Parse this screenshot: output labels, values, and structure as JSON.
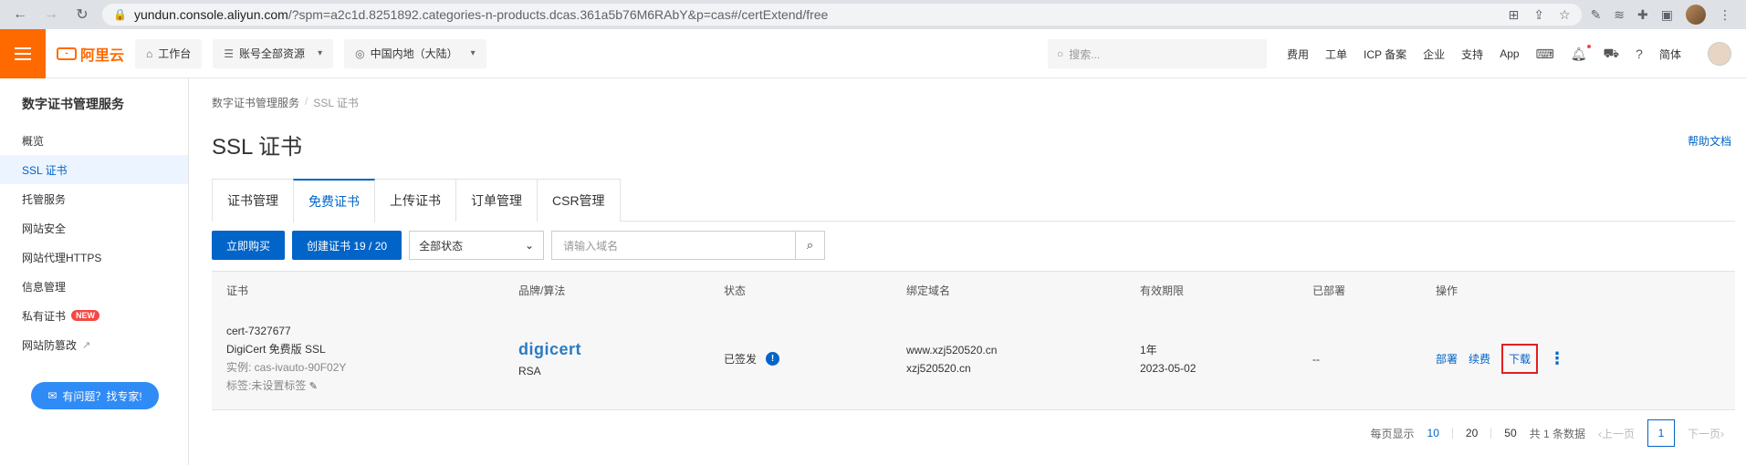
{
  "browser": {
    "url_domain": "yundun.console.aliyun.com",
    "url_path": "/?spm=a2c1d.8251892.categories-n-products.dcas.361a5b76M6RAbY&p=cas#/certExtend/free"
  },
  "topnav": {
    "logo_text": "阿里云",
    "workbench": "工作台",
    "account_resources": "账号全部资源",
    "region": "中国内地（大陆）",
    "search_placeholder": "搜索...",
    "links": [
      "费用",
      "工单",
      "ICP 备案",
      "企业",
      "支持",
      "App"
    ],
    "lang": "简体"
  },
  "sidebar": {
    "title": "数字证书管理服务",
    "items": [
      {
        "label": "概览"
      },
      {
        "label": "SSL 证书"
      },
      {
        "label": "托管服务"
      },
      {
        "label": "网站安全"
      },
      {
        "label": "网站代理HTTPS"
      },
      {
        "label": "信息管理"
      },
      {
        "label": "私有证书",
        "badge": "NEW"
      },
      {
        "label": "网站防篡改"
      }
    ],
    "help_button": "有问题？找专家!"
  },
  "main": {
    "breadcrumb": [
      "数字证书管理服务",
      "SSL 证书"
    ],
    "title": "SSL 证书",
    "help_doc": "帮助文档",
    "tabs": [
      "证书管理",
      "免费证书",
      "上传证书",
      "订单管理",
      "CSR管理"
    ],
    "active_tab": "免费证书",
    "toolbar": {
      "buy": "立即购买",
      "create": "创建证书 19 / 20",
      "status_filter": "全部状态",
      "domain_placeholder": "请输入域名"
    },
    "table": {
      "headers": [
        "证书",
        "品牌/算法",
        "状态",
        "绑定域名",
        "有效期限",
        "已部署",
        "操作"
      ],
      "rows": [
        {
          "cert_id": "cert-7327677",
          "cert_name": "DigiCert 免费版 SSL",
          "instance": "实例: cas-ivauto-90F02Y",
          "tags": "标签:未设置标签",
          "brand": "digicert",
          "algorithm": "RSA",
          "status": "已签发",
          "domain1": "www.xzj520520.cn",
          "domain2": "xzj520520.cn",
          "validity": "1年",
          "expiry": "2023-05-02",
          "deployed": "--",
          "op_deploy": "部署",
          "op_renew": "续费",
          "op_download": "下载"
        }
      ]
    },
    "pager": {
      "per_page_label": "每页显示",
      "sizes": [
        "10",
        "20",
        "50"
      ],
      "total": "共 1 条数据",
      "prev": "上一页",
      "current": "1",
      "next": "下一页"
    }
  },
  "colors": {
    "accent": "#0064c8",
    "brand_orange": "#ff6a00",
    "highlight_red": "#e02020"
  }
}
